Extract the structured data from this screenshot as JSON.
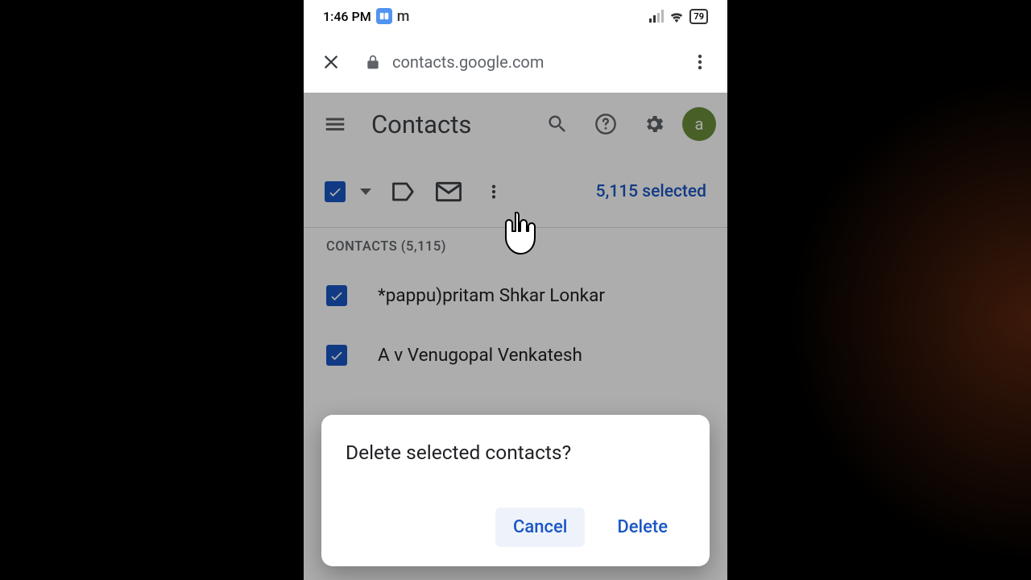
{
  "status": {
    "time": "1:46 PM",
    "m_glyph": "m",
    "battery": "79"
  },
  "browser": {
    "url": "contacts.google.com"
  },
  "app": {
    "title": "Contacts",
    "avatar_letter": "a"
  },
  "selection": {
    "count_label": "5,115 selected"
  },
  "section": {
    "label": "CONTACTS (5,115)"
  },
  "contacts": [
    {
      "name": "*pappu)pritam Shkar Lonkar"
    },
    {
      "name": "A v Venugopal Venkatesh"
    }
  ],
  "dialog": {
    "title": "Delete selected contacts?",
    "cancel": "Cancel",
    "delete": "Delete"
  }
}
